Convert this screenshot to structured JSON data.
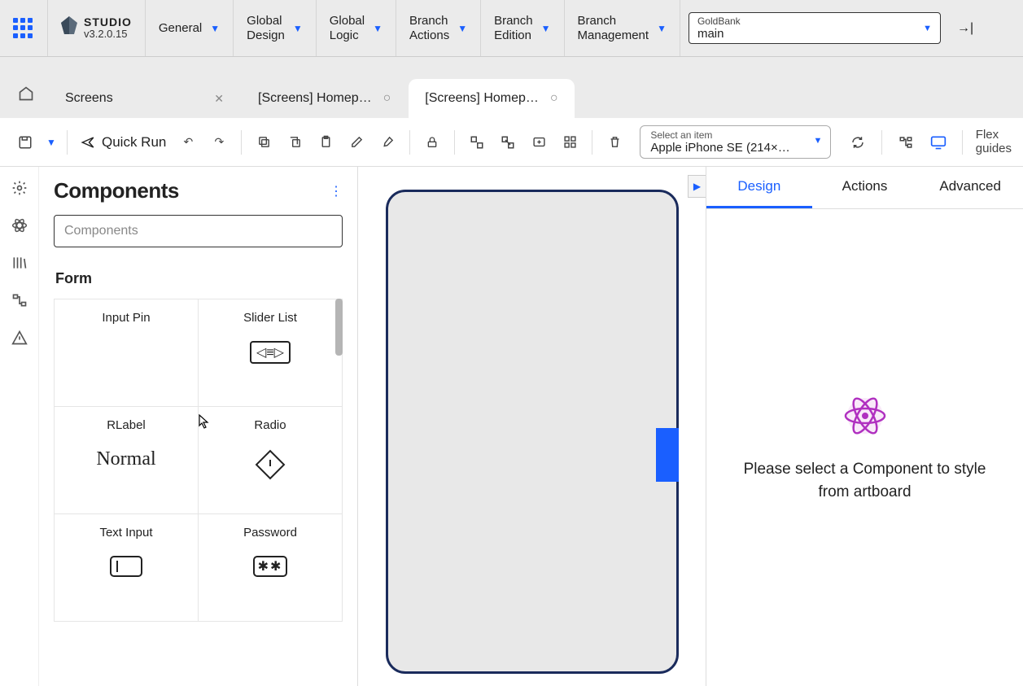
{
  "app": {
    "name": "STUDIO",
    "version": "v3.2.0.15"
  },
  "topmenu": {
    "general": "General",
    "global_design": "Global\nDesign",
    "global_logic": "Global\nLogic",
    "branch_actions": "Branch\nActions",
    "branch_edition": "Branch\nEdition",
    "branch_management": "Branch\nManagement"
  },
  "branch_selector": {
    "label": "GoldBank",
    "value": "main"
  },
  "tabs": [
    {
      "label": "Screens",
      "indicator": "close"
    },
    {
      "label": "[Screens] Homep…",
      "indicator": "circle"
    },
    {
      "label": "[Screens] Homep…",
      "indicator": "circle",
      "active": true
    }
  ],
  "toolbar": {
    "quick_run": "Quick Run",
    "device_label": "Select an item",
    "device_value": "Apple iPhone SE (214×…",
    "flex_guides": "Flex\nguides"
  },
  "components": {
    "title": "Components",
    "search_placeholder": "Components",
    "section": "Form",
    "items": [
      {
        "label": "Input Pin",
        "glyph": ""
      },
      {
        "label": "Slider List",
        "glyph": "slider"
      },
      {
        "label": "RLabel",
        "glyph": "normal"
      },
      {
        "label": "Radio",
        "glyph": "diamond"
      },
      {
        "label": "Text Input",
        "glyph": "textinput"
      },
      {
        "label": "Password",
        "glyph": "password"
      }
    ]
  },
  "right_panel": {
    "tabs": {
      "design": "Design",
      "actions": "Actions",
      "advanced": "Advanced"
    },
    "message": "Please select a Component to style from artboard"
  }
}
